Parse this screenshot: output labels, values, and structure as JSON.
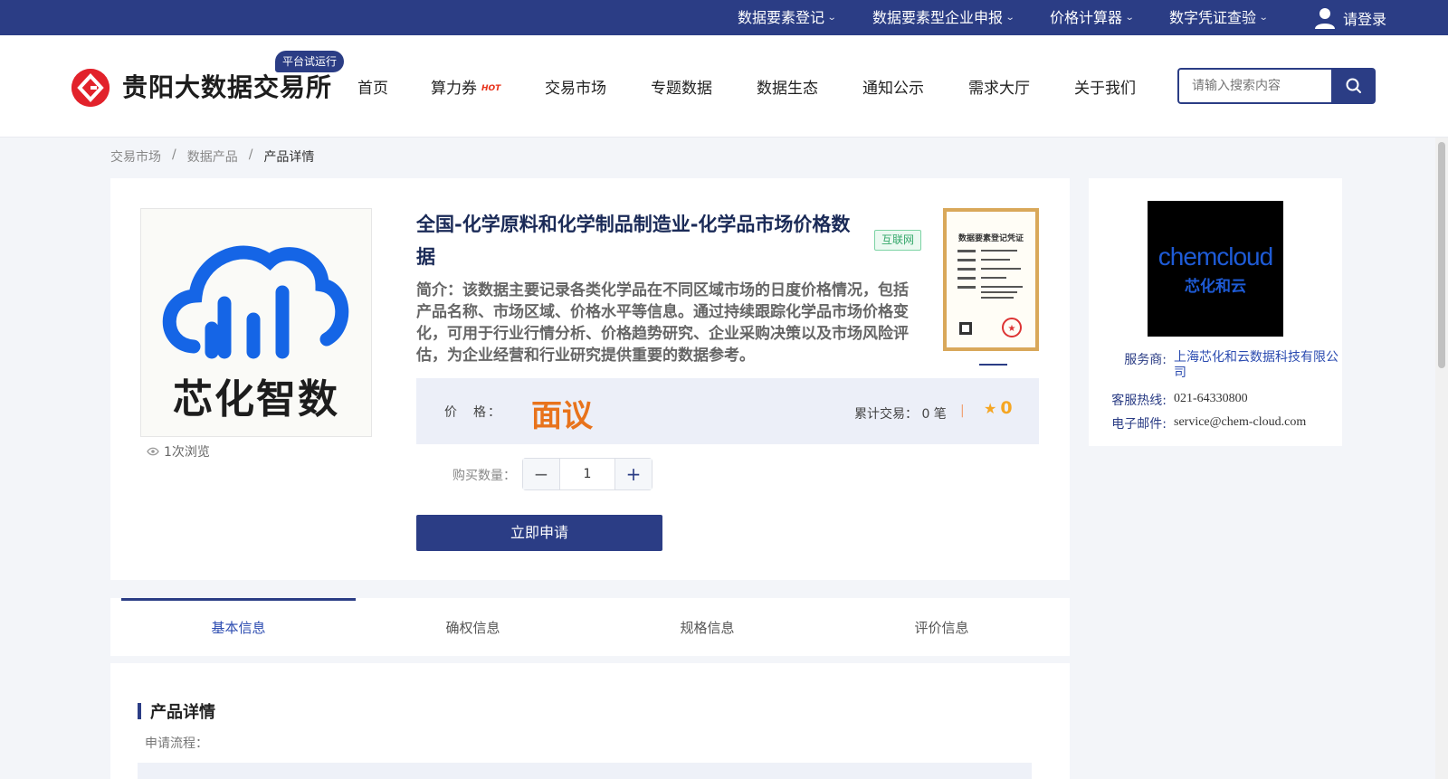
{
  "topbar": {
    "items": [
      {
        "label": "数据要素登记"
      },
      {
        "label": "数据要素型企业申报"
      },
      {
        "label": "价格计算器"
      },
      {
        "label": "数字凭证查验"
      }
    ],
    "login_label": "请登录"
  },
  "header": {
    "logo_text": "贵阳大数据交易所",
    "trial_badge": "平台试运行",
    "nav": [
      {
        "label": "首页"
      },
      {
        "label": "算力券"
      },
      {
        "label": "交易市场"
      },
      {
        "label": "专题数据"
      },
      {
        "label": "数据生态"
      },
      {
        "label": "通知公示"
      },
      {
        "label": "需求大厅"
      },
      {
        "label": "关于我们"
      }
    ],
    "hot_badge": "HOT",
    "search_placeholder": "请输入搜索内容"
  },
  "breadcrumb": {
    "items": [
      "交易市场",
      "数据产品",
      "产品详情"
    ],
    "separator": "/"
  },
  "product": {
    "image_text": "芯化智数",
    "views": "1次浏览",
    "title": "全国-化学原料和化学制品制造业-化学品市场价格数据",
    "tag": "互联网",
    "description": "简介：该数据主要记录各类化学品在不同区域市场的日度价格情况，包括产品名称、市场区域、价格水平等信息。通过持续跟踪化学品市场价格变化，可用于行业行情分析、价格趋势研究、企业采购决策以及市场风险评估，为企业经营和行业研究提供重要的数据参考。",
    "cert_title": "数据要素登记凭证",
    "price_label": "价　格：",
    "price_value": "面议",
    "trades_label": "累计交易：",
    "trades_value": "0 笔",
    "rating": "0",
    "qty_label": "购买数量：",
    "qty_value": "1",
    "apply_label": "立即申请"
  },
  "provider": {
    "logo_text": "chemcloud",
    "logo_sub": "芯化和云",
    "service_label": "服务商:",
    "service_value": "上海芯化和云数据科技有限公司",
    "hotline_label": "客服热线:",
    "hotline_value": "021-64330800",
    "email_label": "电子邮件:",
    "email_value": "service@chem-cloud.com"
  },
  "tabs": [
    {
      "label": "基本信息",
      "active": true
    },
    {
      "label": "确权信息",
      "active": false
    },
    {
      "label": "规格信息",
      "active": false
    },
    {
      "label": "评价信息",
      "active": false
    }
  ],
  "detail": {
    "section_title": "产品详情",
    "apply_flow_label": "申请流程："
  },
  "colors": {
    "brand": "#2b3d85",
    "price": "#e8731c",
    "logo_red": "#e2222b"
  }
}
